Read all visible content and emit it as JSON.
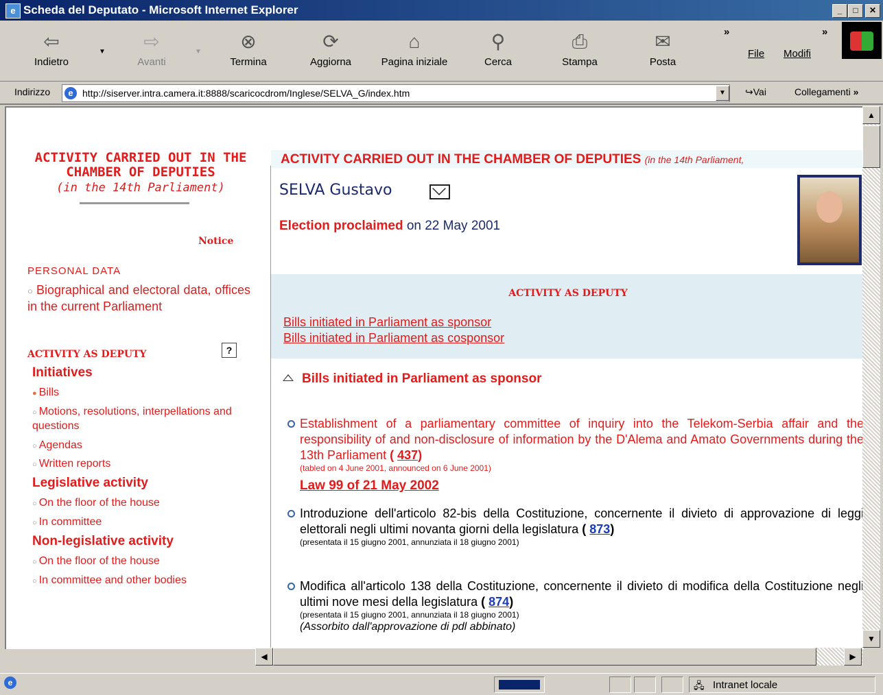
{
  "window": {
    "title": "Scheda del Deputato - Microsoft Internet Explorer",
    "buttons": [
      "_",
      "□",
      "✕"
    ]
  },
  "toolbar": {
    "back": "Indietro",
    "forward": "Avanti",
    "stop": "Termina",
    "refresh": "Aggiorna",
    "home": "Pagina iniziale",
    "search": "Cerca",
    "print": "Stampa",
    "mail": "Posta",
    "chevron": "»",
    "menu_file": "File",
    "menu_edit": "Modifi"
  },
  "address": {
    "label": "Indirizzo",
    "url": "http://siserver.intra.camera.it:8888/scaricocdrom/Inglese/SELVA_G/index.htm",
    "go": "Vai",
    "links": "Collegamenti"
  },
  "left_nav": {
    "heading": "ACTIVITY CARRIED OUT IN THE CHAMBER OF DEPUTIES",
    "subheading": "(in the 14th Parliament)",
    "notice": "Notice",
    "personal_data": "PERSONAL DATA",
    "bio_link": "Biographical and electoral data, offices in the current Parliament",
    "activity_heading": "ACTIVITY AS DEPUTY",
    "help": "?",
    "initiatives": "Initiatives",
    "bills": "Bills",
    "motions": "Motions, resolutions, interpellations and questions",
    "agendas": "Agendas",
    "written_reports": "Written reports",
    "legislative": "Legislative activity",
    "leg_floor": "On the floor of the house",
    "leg_committee": "In committee",
    "nonlegislative": "Non-legislative activity",
    "nonleg_floor": "On the floor of the house",
    "nonleg_committee": "In committee and other bodies"
  },
  "main": {
    "header": "ACTIVITY CARRIED OUT IN THE CHAMBER OF DEPUTIES",
    "header_sub": "(in the 14th Parliament,",
    "deputy_name": "SELVA Gustavo",
    "election_label": "Election proclaimed",
    "election_date": "on 22 May 2001",
    "activity_box_title": "ACTIVITY AS DEPUTY",
    "link_sponsor": "Bills initiated in Parliament as sponsor",
    "link_cosponsor": "Bills initiated in Parliament as cosponsor",
    "section_title": "Bills initiated in Parliament as sponsor",
    "bills": [
      {
        "text": "Establishment of a parliamentary committee of inquiry into the Telekom-Serbia affair and the responsibility of and non-disclosure of information by the D'Alema and Amato Governments during the 13th Parliament",
        "number": "437",
        "note": "(tabled on 4 June 2001, announced on 6 June 2001)",
        "law": "Law 99 of 21 May 2002"
      },
      {
        "text": "Introduzione dell'articolo 82-bis della Costituzione, concernente il divieto di approvazione di leggi elettorali negli ultimi novanta giorni della legislatura",
        "number": "873",
        "note": "(presentata il 15 giugno 2001, annunziata il 18 giugno 2001)"
      },
      {
        "text": "Modifica all'articolo 138 della Costituzione, concernente il divieto di modifica della Costituzione negli ultimi nove mesi della legislatura",
        "number": "874",
        "note": "(presentata il 15 giugno 2001, annunziata il 18 giugno 2001)",
        "status": "(Assorbito dall'approvazione di pdl abbinato)"
      }
    ]
  },
  "statusbar": {
    "zone": "Intranet locale"
  }
}
